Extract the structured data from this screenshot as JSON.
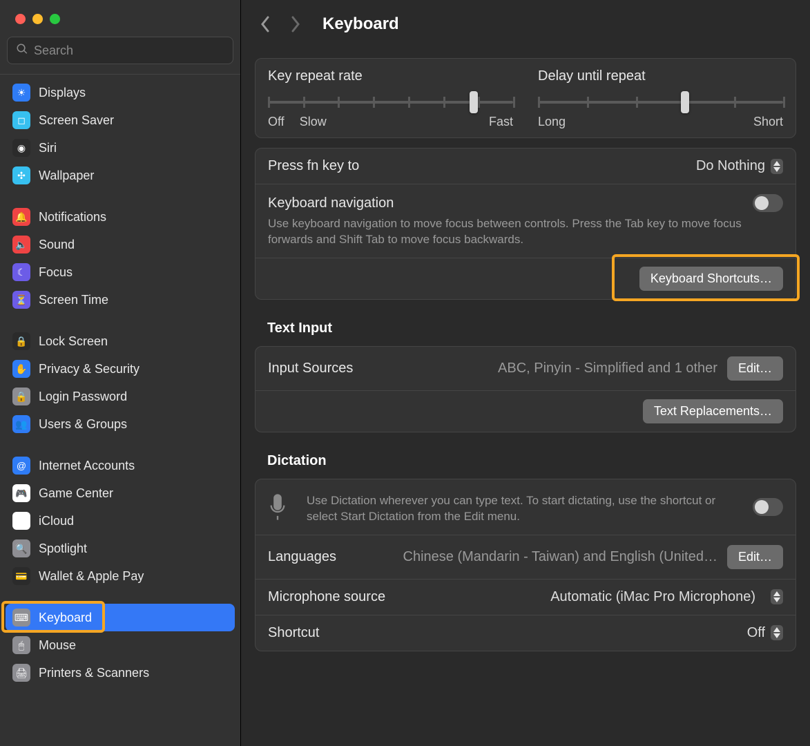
{
  "window": {
    "title": "Keyboard"
  },
  "search": {
    "placeholder": "Search"
  },
  "sidebar": {
    "groups": [
      [
        {
          "id": "displays",
          "label": "Displays",
          "iconColor": "#2f7cf6",
          "glyph": "☀"
        },
        {
          "id": "screensaver",
          "label": "Screen Saver",
          "iconColor": "#37c0f0",
          "glyph": "◻"
        },
        {
          "id": "siri",
          "label": "Siri",
          "iconColor": "#2b2b2b",
          "glyph": "◉"
        },
        {
          "id": "wallpaper",
          "label": "Wallpaper",
          "iconColor": "#37c0f0",
          "glyph": "✣"
        }
      ],
      [
        {
          "id": "notifications",
          "label": "Notifications",
          "iconColor": "#ef4444",
          "glyph": "🔔"
        },
        {
          "id": "sound",
          "label": "Sound",
          "iconColor": "#ef4444",
          "glyph": "🔈"
        },
        {
          "id": "focus",
          "label": "Focus",
          "iconColor": "#6c5ce7",
          "glyph": "☾"
        },
        {
          "id": "screentime",
          "label": "Screen Time",
          "iconColor": "#6c5ce7",
          "glyph": "⏳"
        }
      ],
      [
        {
          "id": "lockscreen",
          "label": "Lock Screen",
          "iconColor": "#2b2b2b",
          "glyph": "🔒"
        },
        {
          "id": "privacy",
          "label": "Privacy & Security",
          "iconColor": "#2f7cf6",
          "glyph": "✋"
        },
        {
          "id": "loginpwd",
          "label": "Login Password",
          "iconColor": "#8e8e93",
          "glyph": "🔒"
        },
        {
          "id": "usersgroups",
          "label": "Users & Groups",
          "iconColor": "#2f7cf6",
          "glyph": "👥"
        }
      ],
      [
        {
          "id": "internetacc",
          "label": "Internet Accounts",
          "iconColor": "#2f7cf6",
          "glyph": "@"
        },
        {
          "id": "gamecenter",
          "label": "Game Center",
          "iconColor": "#ffffff",
          "glyph": "🎮"
        },
        {
          "id": "icloud",
          "label": "iCloud",
          "iconColor": "#ffffff",
          "glyph": "☁"
        },
        {
          "id": "spotlight",
          "label": "Spotlight",
          "iconColor": "#8e8e93",
          "glyph": "🔍"
        },
        {
          "id": "walletpay",
          "label": "Wallet & Apple Pay",
          "iconColor": "#2b2b2b",
          "glyph": "💳"
        }
      ],
      [
        {
          "id": "keyboard",
          "label": "Keyboard",
          "iconColor": "#8e8e93",
          "glyph": "⌨",
          "selected": true
        },
        {
          "id": "mouse",
          "label": "Mouse",
          "iconColor": "#8e8e93",
          "glyph": "🖱"
        },
        {
          "id": "printers",
          "label": "Printers & Scanners",
          "iconColor": "#8e8e93",
          "glyph": "🖨"
        }
      ]
    ]
  },
  "sliders": {
    "keyRepeat": {
      "label": "Key repeat rate",
      "min": "Off",
      "minExtra": "Slow",
      "max": "Fast",
      "ticks": 8,
      "pos": 0.84
    },
    "delay": {
      "label": "Delay until repeat",
      "min": "Long",
      "max": "Short",
      "ticks": 6,
      "pos": 0.6
    }
  },
  "fnKey": {
    "label": "Press fn key to",
    "value": "Do Nothing"
  },
  "keyboardNav": {
    "label": "Keyboard navigation",
    "desc": "Use keyboard navigation to move focus between controls. Press the Tab key to move focus forwards and Shift Tab to move focus backwards."
  },
  "buttons": {
    "keyboardShortcuts": "Keyboard Shortcuts…",
    "editInputSources": "Edit…",
    "textReplacements": "Text Replacements…",
    "editLanguages": "Edit…"
  },
  "textInput": {
    "header": "Text Input",
    "inputSources": {
      "label": "Input Sources",
      "value": "ABC, Pinyin - Simplified and 1 other"
    }
  },
  "dictation": {
    "header": "Dictation",
    "desc": "Use Dictation wherever you can type text. To start dictating, use the shortcut or select Start Dictation from the Edit menu.",
    "languages": {
      "label": "Languages",
      "value": "Chinese (Mandarin - Taiwan) and English (United…"
    },
    "micSource": {
      "label": "Microphone source",
      "value": "Automatic (iMac Pro Microphone)"
    },
    "shortcut": {
      "label": "Shortcut",
      "value": "Off"
    }
  }
}
